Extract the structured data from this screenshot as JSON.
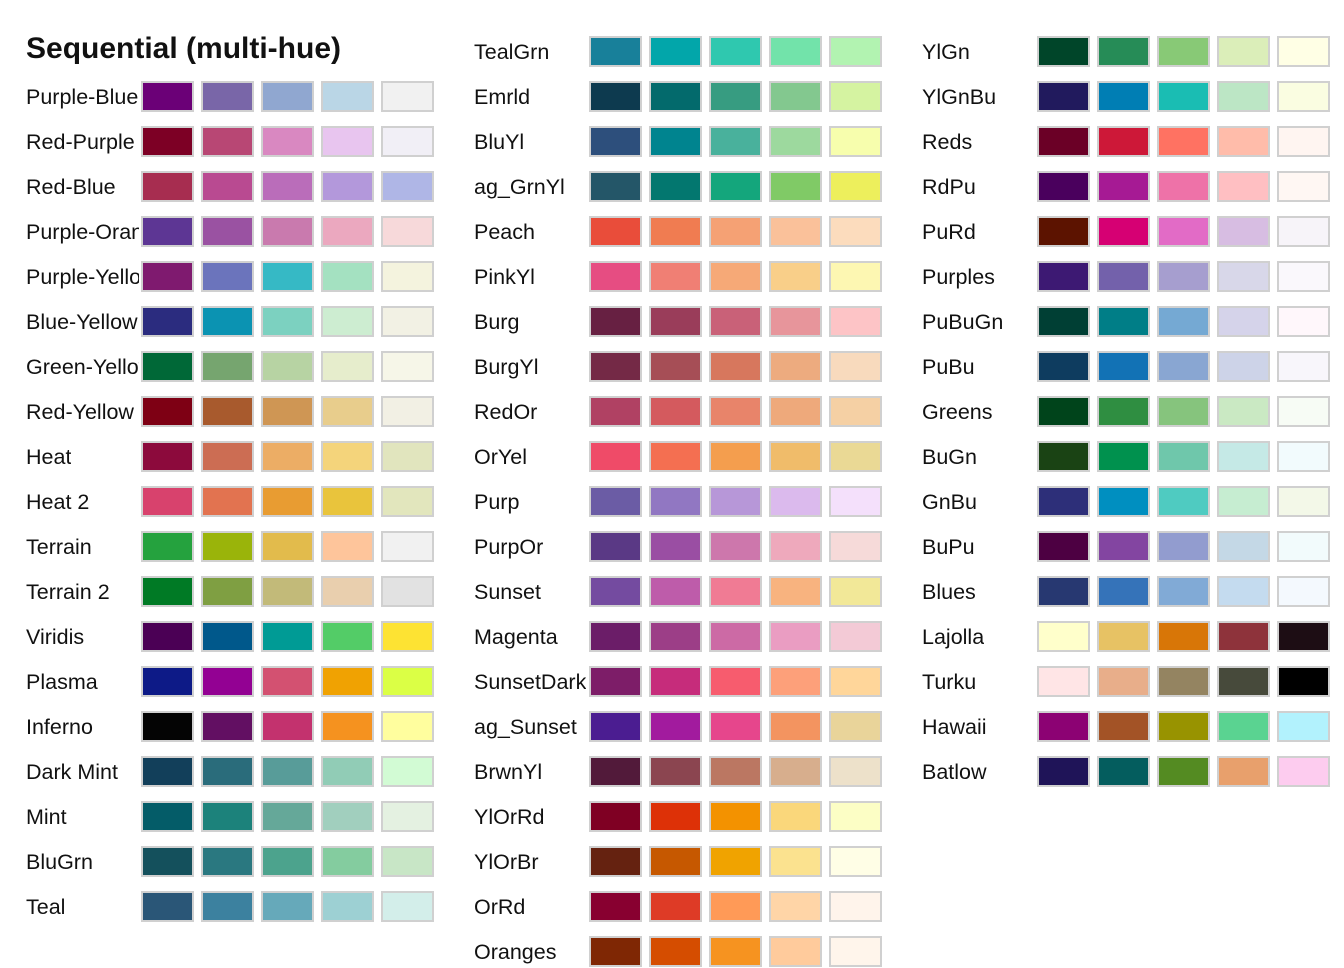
{
  "chart_data": {
    "type": "table",
    "title": "Sequential (multi-hue)",
    "palettes": [
      {
        "name": "Purple-Blue",
        "colors": [
          "#6B0077",
          "#7966A8",
          "#90A7D0",
          "#BAD6E6",
          "#F1F1F1"
        ]
      },
      {
        "name": "Red-Purple",
        "colors": [
          "#7D0025",
          "#B84774",
          "#D988C1",
          "#E8C5EF",
          "#F1EFF6"
        ]
      },
      {
        "name": "Red-Blue",
        "colors": [
          "#A72D50",
          "#B94A91",
          "#BA6DBA",
          "#B398DB",
          "#AFB6E6"
        ]
      },
      {
        "name": "Purple-Orange",
        "colors": [
          "#5D3694",
          "#9A52A2",
          "#C97AAE",
          "#EBA8BF",
          "#F7D9DA"
        ]
      },
      {
        "name": "Purple-Yellow",
        "colors": [
          "#7F1A6F",
          "#6B74BC",
          "#36B9C5",
          "#A4E1C1",
          "#F4F3DE"
        ]
      },
      {
        "name": "Blue-Yellow",
        "colors": [
          "#2B2C7F",
          "#0B93B2",
          "#7CD1C0",
          "#CDEDD1",
          "#F2F1E4"
        ]
      },
      {
        "name": "Green-Yellow",
        "colors": [
          "#006837",
          "#76A56F",
          "#B7D3A3",
          "#E6EDCC",
          "#F6F6E8"
        ]
      },
      {
        "name": "Red-Yellow",
        "colors": [
          "#7E0014",
          "#A85A2D",
          "#CF9654",
          "#E8CD8C",
          "#F2F0E4"
        ]
      },
      {
        "name": "Heat",
        "colors": [
          "#8C0A3C",
          "#CC6D53",
          "#ECAD65",
          "#F4D47B",
          "#E1E5BE"
        ]
      },
      {
        "name": "Heat 2",
        "colors": [
          "#D8426D",
          "#E27350",
          "#E89C32",
          "#E9C43C",
          "#E2E6BD"
        ]
      },
      {
        "name": "Terrain",
        "colors": [
          "#25A23E",
          "#9AB40A",
          "#E2BB4C",
          "#FEC59B",
          "#F1F1F1"
        ]
      },
      {
        "name": "Terrain 2",
        "colors": [
          "#007A25",
          "#7F9F42",
          "#C2BA79",
          "#E9CFAE",
          "#E2E2E2"
        ]
      },
      {
        "name": "Viridis",
        "colors": [
          "#4B0055",
          "#00588B",
          "#009B95",
          "#53CC67",
          "#FDE333"
        ]
      },
      {
        "name": "Plasma",
        "colors": [
          "#0D1A87",
          "#930193",
          "#D35171",
          "#F0A202",
          "#DBFF45"
        ]
      },
      {
        "name": "Inferno",
        "colors": [
          "#040404",
          "#620F62",
          "#C3326E",
          "#F5921F",
          "#FFFE9E"
        ]
      },
      {
        "name": "Dark Mint",
        "colors": [
          "#123F5A",
          "#2A6C7B",
          "#589C99",
          "#91CCB6",
          "#D2FBD4"
        ]
      },
      {
        "name": "Mint",
        "colors": [
          "#045C68",
          "#1C827B",
          "#65A899",
          "#A1CFBE",
          "#E4F1E1"
        ]
      },
      {
        "name": "BluGrn",
        "colors": [
          "#14505C",
          "#2A7880",
          "#4CA38D",
          "#84CC9F",
          "#C8E6C6"
        ]
      },
      {
        "name": "Teal",
        "colors": [
          "#2A5677",
          "#3C819F",
          "#66A9BA",
          "#9DD0D3",
          "#D3EEEA"
        ]
      },
      {
        "name": "TealGrn",
        "colors": [
          "#18809A",
          "#02A6AA",
          "#2FC8AF",
          "#72E3AA",
          "#B2F3B1"
        ]
      },
      {
        "name": "Emrld",
        "colors": [
          "#0D3A4F",
          "#036A6C",
          "#379C81",
          "#83C88F",
          "#D5F3A1"
        ]
      },
      {
        "name": "BluYl",
        "colors": [
          "#2D4F7C",
          "#00848F",
          "#49B19C",
          "#9DD99E",
          "#F7FEAD"
        ]
      },
      {
        "name": "ag_GrnYl",
        "colors": [
          "#245668",
          "#03776F",
          "#14A67C",
          "#80CA66",
          "#EDEF5C"
        ]
      },
      {
        "name": "Peach",
        "colors": [
          "#E94D3A",
          "#F07C51",
          "#F5A174",
          "#FAC19A",
          "#FCDCBD"
        ]
      },
      {
        "name": "PinkYl",
        "colors": [
          "#E64D82",
          "#F07F74",
          "#F6A977",
          "#F9CF89",
          "#FDF7B2"
        ]
      },
      {
        "name": "Burg",
        "colors": [
          "#672042",
          "#9A3D5A",
          "#C96178",
          "#E7959B",
          "#FDC4C6"
        ]
      },
      {
        "name": "BurgYl",
        "colors": [
          "#742946",
          "#A64E56",
          "#D7775D",
          "#EDAB7F",
          "#F8DABD"
        ]
      },
      {
        "name": "RedOr",
        "colors": [
          "#B04163",
          "#D45A5E",
          "#E8846A",
          "#EEA97B",
          "#F5D0A4"
        ]
      },
      {
        "name": "OrYel",
        "colors": [
          "#EF4B68",
          "#F46F51",
          "#F49E4E",
          "#F0BC6A",
          "#EAD995"
        ]
      },
      {
        "name": "Purp",
        "colors": [
          "#6B5CA5",
          "#9177C2",
          "#B797D8",
          "#DBBAED",
          "#F4E0FB"
        ]
      },
      {
        "name": "PurpOr",
        "colors": [
          "#5A3985",
          "#9A4EA3",
          "#CD77AC",
          "#EEA9BC",
          "#F6DAD9"
        ]
      },
      {
        "name": "Sunset",
        "colors": [
          "#744BA0",
          "#BE5CAA",
          "#F07B94",
          "#F8B37F",
          "#F2E898"
        ]
      },
      {
        "name": "Magenta",
        "colors": [
          "#6B1D68",
          "#9C3E87",
          "#CC6AA5",
          "#EA9DC2",
          "#F3CAD6"
        ]
      },
      {
        "name": "SunsetDark",
        "colors": [
          "#7D1D68",
          "#C62C7B",
          "#F75C6E",
          "#FDA07A",
          "#FFD69A"
        ]
      },
      {
        "name": "ag_Sunset",
        "colors": [
          "#4B1D91",
          "#A21B9E",
          "#E6468C",
          "#F39460",
          "#E9D49A"
        ]
      },
      {
        "name": "BrwnYl",
        "colors": [
          "#521A3A",
          "#8B4550",
          "#BB7762",
          "#D7AE8D",
          "#EDE1CA"
        ]
      },
      {
        "name": "YlOrRd",
        "colors": [
          "#7F0023",
          "#DD3107",
          "#F39200",
          "#FAD77B",
          "#FCFEC5"
        ]
      },
      {
        "name": "YlOrBr",
        "colors": [
          "#652210",
          "#C65800",
          "#F0A300",
          "#FBE28F",
          "#FFFEE6"
        ]
      },
      {
        "name": "OrRd",
        "colors": [
          "#880030",
          "#DE3B26",
          "#FF9A57",
          "#FFD5A7",
          "#FFF4EB"
        ]
      },
      {
        "name": "Oranges",
        "colors": [
          "#7F2704",
          "#D54D00",
          "#F69320",
          "#FFCB9C",
          "#FFF5EB"
        ]
      },
      {
        "name": "YlGn",
        "colors": [
          "#004529",
          "#268C57",
          "#88C976",
          "#DBEEB9",
          "#FFFFE5"
        ]
      },
      {
        "name": "YlGnBu",
        "colors": [
          "#211A5D",
          "#007EB4",
          "#1ABDB3",
          "#BCE6C5",
          "#FAFDE1"
        ]
      },
      {
        "name": "Reds",
        "colors": [
          "#6B0026",
          "#CD1838",
          "#FF7262",
          "#FFBCAA",
          "#FFF5F1"
        ]
      },
      {
        "name": "RdPu",
        "colors": [
          "#4A005D",
          "#A61A94",
          "#EE72A8",
          "#FFBFC2",
          "#FFF7F3"
        ]
      },
      {
        "name": "PuRd",
        "colors": [
          "#5C1300",
          "#D60073",
          "#E26BC6",
          "#D7BDE2",
          "#F7F4F9"
        ]
      },
      {
        "name": "Purples",
        "colors": [
          "#3D1973",
          "#7361AB",
          "#A69ECF",
          "#D8D7E9",
          "#FAF8FC"
        ]
      },
      {
        "name": "PuBuGn",
        "colors": [
          "#003F34",
          "#007E87",
          "#75A9D3",
          "#D5D3EA",
          "#FFF7FB"
        ]
      },
      {
        "name": "PuBu",
        "colors": [
          "#0E3C5F",
          "#1272B5",
          "#89A6D2",
          "#CDD3E8",
          "#F8F6FB"
        ]
      },
      {
        "name": "Greens",
        "colors": [
          "#00441B",
          "#2F8E41",
          "#86C47D",
          "#CAE9C3",
          "#F7FCF5"
        ]
      },
      {
        "name": "BuGn",
        "colors": [
          "#1A4314",
          "#00914E",
          "#6FC7AB",
          "#C5E9E6",
          "#F2FBFD"
        ]
      },
      {
        "name": "GnBu",
        "colors": [
          "#2D2F79",
          "#008FC0",
          "#4FCBC1",
          "#C6EDD1",
          "#F3F8E8"
        ]
      },
      {
        "name": "BuPu",
        "colors": [
          "#4D0042",
          "#8345A1",
          "#929CCF",
          "#C4D8E6",
          "#F2FBFC"
        ]
      },
      {
        "name": "Blues",
        "colors": [
          "#273871",
          "#3573B9",
          "#81AAD6",
          "#C4DBEF",
          "#F4F9FE"
        ]
      },
      {
        "name": "Lajolla",
        "colors": [
          "#FFFFCB",
          "#E7C264",
          "#D87607",
          "#8E333B",
          "#1D0D14"
        ]
      },
      {
        "name": "Turku",
        "colors": [
          "#FFE5E6",
          "#E8AE8A",
          "#948461",
          "#474A3B",
          "#000000"
        ]
      },
      {
        "name": "Hawaii",
        "colors": [
          "#8C0273",
          "#A35326",
          "#989300",
          "#5AD391",
          "#B2F2FD"
        ]
      },
      {
        "name": "Batlow",
        "colors": [
          "#1F1458",
          "#045D5E",
          "#548B22",
          "#E8A06C",
          "#FDCCEF"
        ]
      }
    ]
  }
}
